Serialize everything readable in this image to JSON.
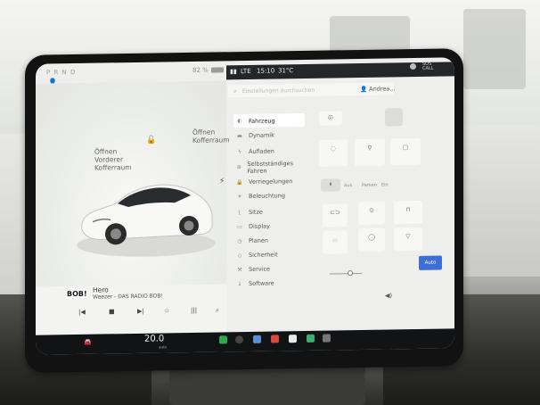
{
  "status": {
    "gear": "P R N D",
    "battery_percent": "82 %",
    "time": "15:10",
    "temperature_outside": "31°C",
    "lte": "LTE"
  },
  "car_view": {
    "open_frunk": [
      "Öffnen",
      "Vorderer",
      "Kofferraum"
    ],
    "open_trunk": [
      "Öffnen",
      "Kofferraum"
    ]
  },
  "media": {
    "logo": "BOB!",
    "title": "Hero",
    "station": "Weezer - DAS RADIO BOB!",
    "controls": [
      "|◀",
      "■",
      "▶|",
      "☆",
      "|||",
      "⌕"
    ]
  },
  "settings": {
    "search_placeholder": "Einstellungen durchsuchen",
    "user": "Andrea",
    "menu": [
      {
        "label": "Fahrzeug",
        "icon": "car-icon",
        "active": true
      },
      {
        "label": "Dynamik",
        "icon": "dynamics-icon"
      },
      {
        "label": "Aufladen",
        "icon": "charge-icon"
      },
      {
        "label": "Selbstständiges Fahren",
        "icon": "steering-icon"
      },
      {
        "label": "Verriegelungen",
        "icon": "lock-icon"
      },
      {
        "label": "Beleuchtung",
        "icon": "light-icon"
      },
      {
        "label": "Sitze",
        "icon": "seat-icon"
      },
      {
        "label": "Display",
        "icon": "display-icon"
      },
      {
        "label": "Planen",
        "icon": "schedule-icon"
      },
      {
        "label": "Sicherheit",
        "icon": "shield-icon"
      },
      {
        "label": "Service",
        "icon": "wrench-icon"
      },
      {
        "label": "Software",
        "icon": "download-icon"
      }
    ],
    "auto_button": "Auto",
    "headlight_segments": [
      "Aus",
      "Parken",
      "Ein"
    ]
  },
  "dock": {
    "cabin_temp": "20.0",
    "cabin_temp_sub": "auto"
  }
}
